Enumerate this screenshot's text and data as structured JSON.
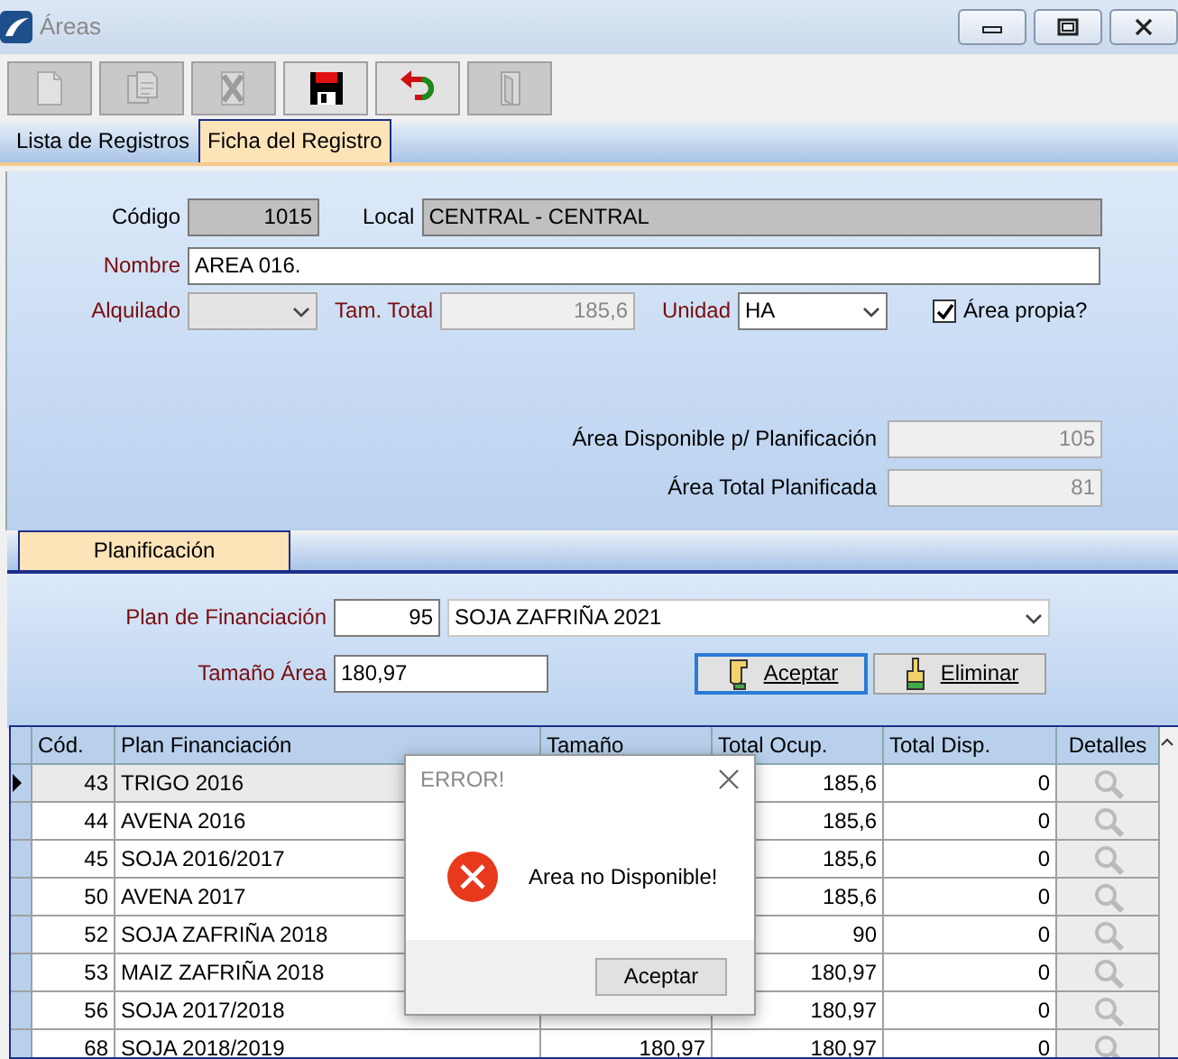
{
  "window": {
    "title": "Áreas"
  },
  "toolbar": [
    {
      "kind": "new",
      "disabled": true
    },
    {
      "kind": "copy",
      "disabled": true
    },
    {
      "kind": "delete",
      "disabled": true
    },
    {
      "kind": "save",
      "disabled": false
    },
    {
      "kind": "undo",
      "disabled": false
    },
    {
      "kind": "exit",
      "disabled": true
    }
  ],
  "tabs": [
    {
      "label": "Lista de Registros",
      "selected": false
    },
    {
      "label": "Ficha del Registro",
      "selected": true
    }
  ],
  "form": {
    "codigo": {
      "label": "Código",
      "value": "1015",
      "required": false
    },
    "local": {
      "label": "Local",
      "value": "CENTRAL - CENTRAL",
      "required": false
    },
    "nombre": {
      "label": "Nombre",
      "value": "AREA 016.",
      "required": true
    },
    "alquilado": {
      "label": "Alquilado",
      "required": true
    },
    "tam_total": {
      "label": "Tam. Total",
      "value": "185,6",
      "required": true
    },
    "unidad": {
      "label": "Unidad",
      "value": "HA",
      "required": true
    },
    "area_propia": {
      "label": "Área propia?",
      "checked": true
    },
    "area_disponible": {
      "label": "Área Disponible p/ Planificación",
      "value": "105"
    },
    "area_planificada": {
      "label": "Área Total Planificada",
      "value": "81"
    }
  },
  "plan_tabs": [
    {
      "label": "Planificación",
      "selected": true
    }
  ],
  "planificacion": {
    "plan": {
      "label": "Plan de Financiación",
      "code": "95",
      "value": "SOJA ZAFRIÑA 2021",
      "required": true
    },
    "tamano": {
      "label": "Tamaño Área",
      "value": "180,97",
      "required": true
    },
    "buttons": [
      {
        "label": "Aceptar",
        "focused": true
      },
      {
        "label": "Eliminar",
        "focused": false
      }
    ]
  },
  "grid": {
    "columns": [
      "Cód.",
      "Plan Financiación",
      "Tamaño",
      "Total Ocup.",
      "Total Disp.",
      "Detalles"
    ],
    "rows": [
      {
        "cod": "43",
        "plan": "TRIGO 2016",
        "total_ocup": "185,6",
        "total_disp": "0",
        "current": true
      },
      {
        "cod": "44",
        "plan": "AVENA 2016",
        "total_ocup": "185,6",
        "total_disp": "0",
        "current": false
      },
      {
        "cod": "45",
        "plan": "SOJA 2016/2017",
        "total_ocup": "185,6",
        "total_disp": "0",
        "current": false
      },
      {
        "cod": "50",
        "plan": "AVENA 2017",
        "total_ocup": "185,6",
        "total_disp": "0",
        "current": false
      },
      {
        "cod": "52",
        "plan": "SOJA ZAFRIÑA 2018",
        "total_ocup": "90",
        "total_disp": "0",
        "current": false
      },
      {
        "cod": "53",
        "plan": "MAIZ ZAFRIÑA 2018",
        "total_ocup": "180,97",
        "total_disp": "0",
        "current": false
      },
      {
        "cod": "56",
        "plan": "SOJA 2017/2018",
        "total_ocup": "180,97",
        "total_disp": "0",
        "current": false
      },
      {
        "cod": "68",
        "plan": "SOJA 2018/2019",
        "tamano": "180,97",
        "total_ocup": "180,97",
        "total_disp": "0",
        "current": false
      }
    ]
  },
  "dialog": {
    "title": "ERROR!",
    "message": "Area no Disponible!",
    "button": "Aceptar"
  }
}
